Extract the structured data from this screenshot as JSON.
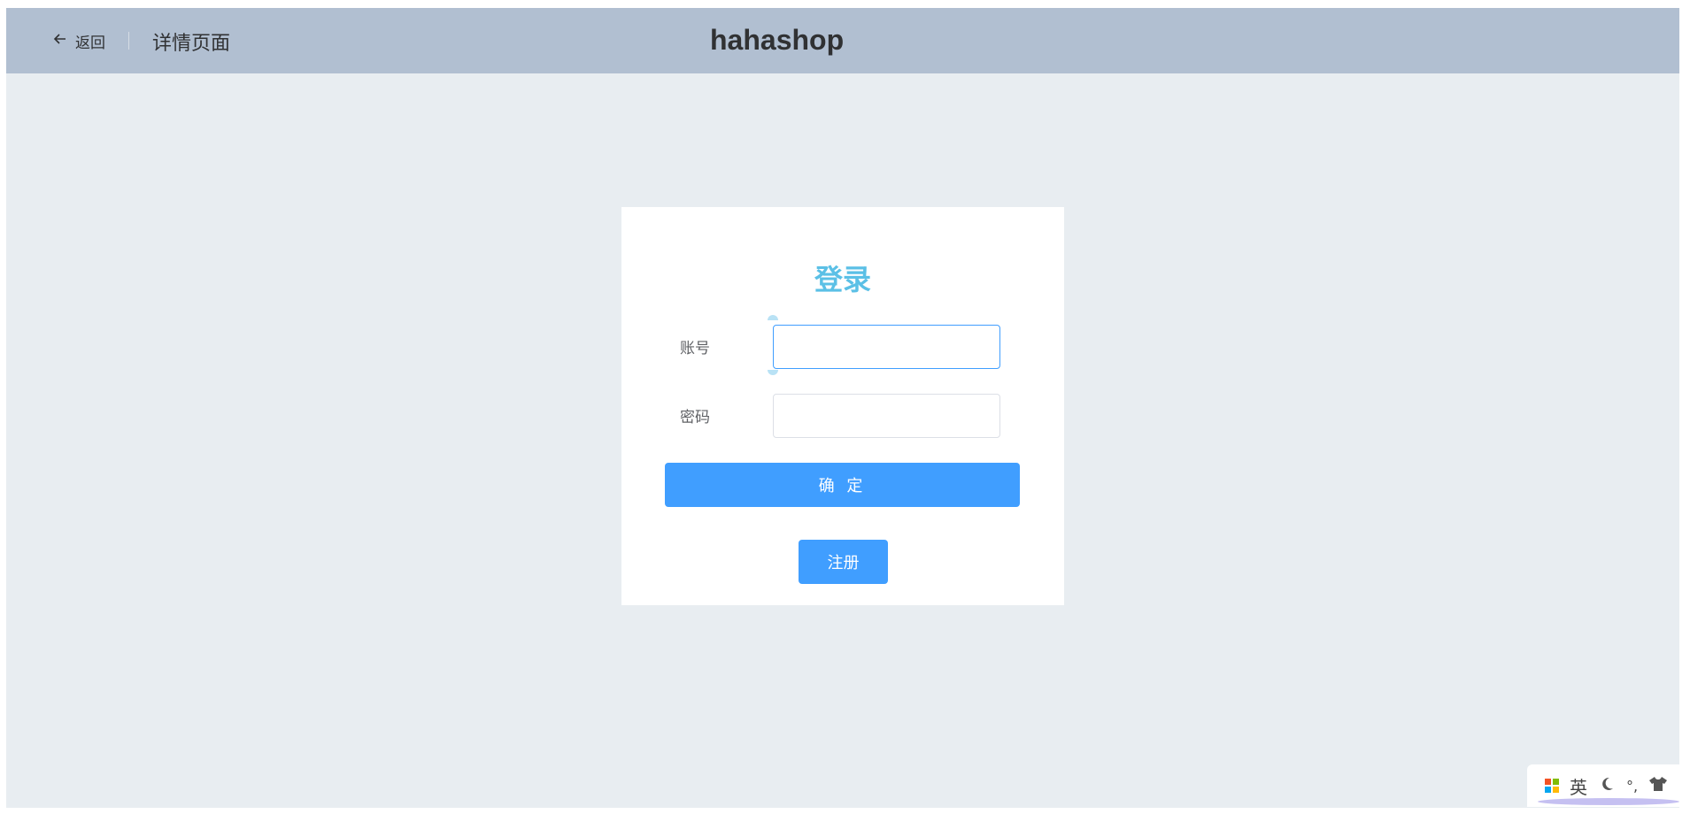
{
  "header": {
    "back_label": "返回",
    "page_title": "详情页面",
    "brand": "hahashop"
  },
  "login": {
    "title": "登录",
    "account_label": "账号",
    "account_value": "",
    "password_label": "密码",
    "password_value": "",
    "confirm_label": "确 定",
    "register_label": "注册"
  },
  "ime_toolbar": {
    "mode_label": "英",
    "punctuation_label": "°,",
    "icons": [
      "windows-logo-icon",
      "moon-icon",
      "shirt-icon"
    ]
  },
  "colors": {
    "header_bg": "#b1bfd1",
    "page_bg": "#e8edf1",
    "title_color": "#5bc0e6",
    "primary_button": "#409eff"
  }
}
